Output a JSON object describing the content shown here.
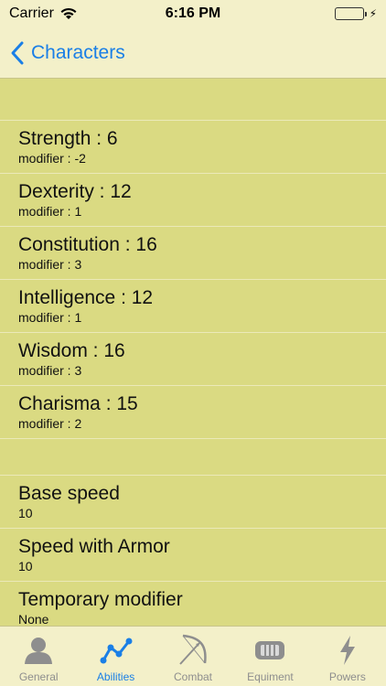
{
  "status": {
    "carrier": "Carrier",
    "time": "6:16 PM"
  },
  "nav": {
    "back_label": "Characters"
  },
  "abilities": [
    {
      "title": "Strength : 6",
      "sub": "modifier : -2"
    },
    {
      "title": "Dexterity : 12",
      "sub": "modifier : 1"
    },
    {
      "title": "Constitution : 16",
      "sub": "modifier : 3"
    },
    {
      "title": "Intelligence : 12",
      "sub": "modifier : 1"
    },
    {
      "title": "Wisdom : 16",
      "sub": "modifier : 3"
    },
    {
      "title": "Charisma : 15",
      "sub": "modifier : 2"
    }
  ],
  "speed": [
    {
      "title": "Base speed",
      "sub": "10"
    },
    {
      "title": "Speed with Armor",
      "sub": "10"
    },
    {
      "title": "Temporary modifier",
      "sub": "None"
    }
  ],
  "tabs": [
    {
      "label": "General",
      "icon": "person-icon"
    },
    {
      "label": "Abilities",
      "icon": "graph-icon"
    },
    {
      "label": "Combat",
      "icon": "bow-icon"
    },
    {
      "label": "Equiment",
      "icon": "armor-icon"
    },
    {
      "label": "Powers",
      "icon": "lightning-icon"
    }
  ],
  "colors": {
    "accent": "#1a7fe6",
    "background": "#dada82",
    "bars": "#f3f0c9"
  }
}
